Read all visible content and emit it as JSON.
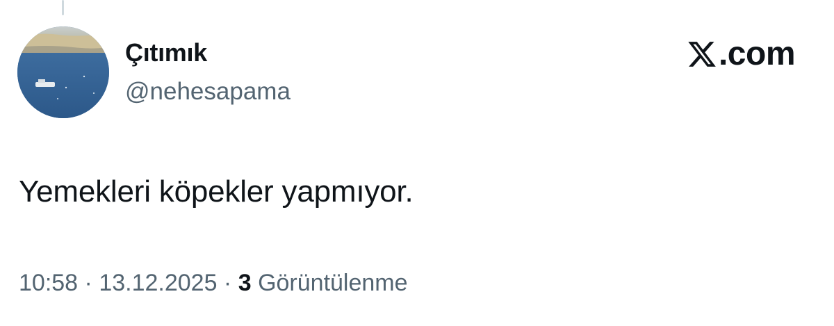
{
  "author": {
    "display_name": "Çıtımık",
    "handle": "@nehesapama"
  },
  "brand": {
    "logo_icon": "x-logo-icon",
    "text": ".com"
  },
  "tweet": {
    "text": "Yemekleri köpekler yapmıyor."
  },
  "meta": {
    "time": "10:58",
    "separator": " · ",
    "date": "13.12.2025",
    "views_count": "3",
    "views_label": "Görüntülenme"
  },
  "colors": {
    "text_primary": "#0f1419",
    "text_secondary": "#536471",
    "thread_line": "#cfd9de"
  }
}
